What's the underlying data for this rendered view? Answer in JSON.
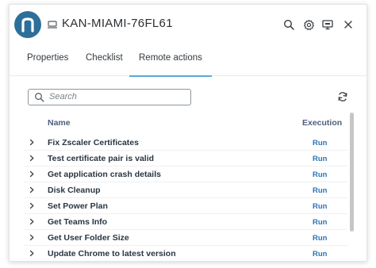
{
  "header": {
    "title": "KAN-MIAMI-76FL61",
    "logo_letter": "n",
    "brand_color": "#2d6f9b"
  },
  "tabs": [
    {
      "label": "Properties",
      "active": false
    },
    {
      "label": "Checklist",
      "active": false
    },
    {
      "label": "Remote actions",
      "active": true
    }
  ],
  "search": {
    "placeholder": "Search",
    "value": ""
  },
  "table": {
    "col_name": "Name",
    "col_execution": "Execution",
    "rows": [
      {
        "name": "Fix Zscaler Certificates",
        "action": "Run"
      },
      {
        "name": "Test certificate pair is valid",
        "action": "Run"
      },
      {
        "name": "Get application crash details",
        "action": "Run"
      },
      {
        "name": "Disk Cleanup",
        "action": "Run"
      },
      {
        "name": "Set Power Plan",
        "action": "Run"
      },
      {
        "name": "Get Teams Info",
        "action": "Run"
      },
      {
        "name": "Get User Folder Size",
        "action": "Run"
      },
      {
        "name": "Update Chrome to latest version",
        "action": "Run"
      }
    ]
  },
  "icons": {
    "device": "desktop-icon",
    "search": "search-icon",
    "settings": "gear-icon",
    "screen": "remote-screen-icon",
    "close": "close-icon",
    "refresh": "refresh-icon",
    "expand": "chevron-right-icon"
  }
}
